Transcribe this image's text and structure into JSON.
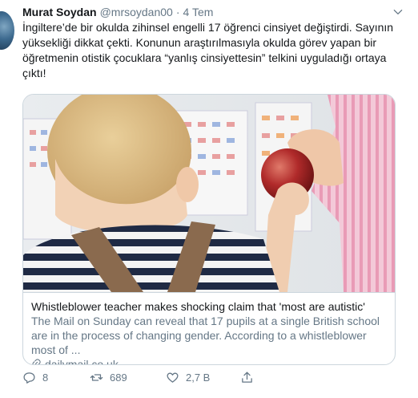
{
  "tweet": {
    "author_name": "Murat Soydan",
    "author_handle": "@mrsoydan00",
    "separator": "·",
    "date": "4 Tem",
    "text": "İngiltere’de bir okulda zihinsel engelli 17 öğrenci cinsiyet değiştirdi. Sayının yüksekliği dikkat çekti. Konunun araştırılmasıyla okulda görev yapan bir öğretmenin otistik çocuklara “yanlış cinsiyettesin” telkini uyguladığı ortaya çıktı!"
  },
  "card": {
    "title": "Whistleblower teacher makes shocking claim that 'most are autistic'",
    "description": "The Mail on Sunday can reveal that 17 pupils at a single British school are in the process of changing gender. According to a whistleblower most of ...",
    "domain": "dailymail.co.uk"
  },
  "actions": {
    "replies": "8",
    "retweets": "689",
    "likes": "2,7 B"
  },
  "colors": {
    "text": "#14171a",
    "secondary": "#657786",
    "border": "#ccd6dd"
  },
  "icons": [
    "chevron-down-icon",
    "link-icon",
    "reply-icon",
    "retweet-icon",
    "like-icon",
    "share-icon"
  ]
}
